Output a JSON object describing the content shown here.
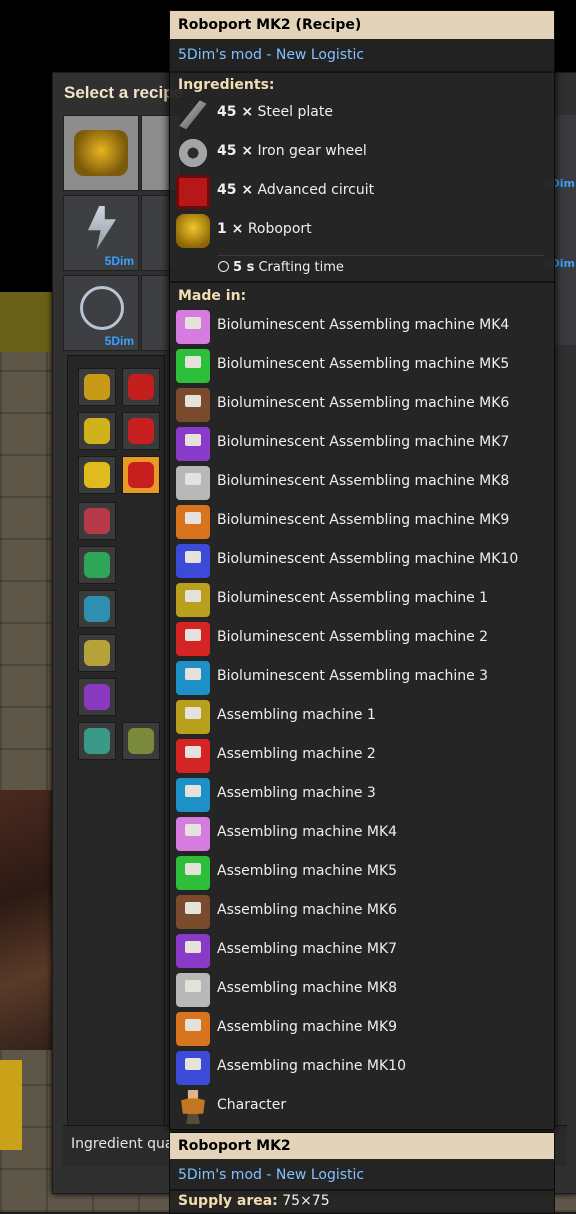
{
  "recipe_window": {
    "title": "Select a recipe",
    "group_badge": "5Dim",
    "bottom_label": "Ingredient quali"
  },
  "tooltip": {
    "title": "Roboport MK2 (Recipe)",
    "mod": "5Dim's mod - New Logistic",
    "ingredients_label": "Ingredients:",
    "ingredients": [
      {
        "amount": "45 ×",
        "name": "Steel plate",
        "icon": "steel-plate-icon"
      },
      {
        "amount": "45 ×",
        "name": "Iron gear wheel",
        "icon": "iron-gear-wheel-icon"
      },
      {
        "amount": "45 ×",
        "name": "Advanced circuit",
        "icon": "advanced-circuit-icon"
      },
      {
        "amount": "1 ×",
        "name": "Roboport",
        "icon": "roboport-icon"
      }
    ],
    "crafting_time_value": "5 s",
    "crafting_time_label": "Crafting time",
    "made_in_label": "Made in:",
    "made_in": [
      {
        "name": "Bioluminescent Assembling machine MK4",
        "color": "#d67be0"
      },
      {
        "name": "Bioluminescent Assembling machine MK5",
        "color": "#2ebf3a"
      },
      {
        "name": "Bioluminescent Assembling machine MK6",
        "color": "#7a4a2c"
      },
      {
        "name": "Bioluminescent Assembling machine MK7",
        "color": "#8a3ac8"
      },
      {
        "name": "Bioluminescent Assembling machine MK8",
        "color": "#b8b8b8"
      },
      {
        "name": "Bioluminescent Assembling machine MK9",
        "color": "#d8741e"
      },
      {
        "name": "Bioluminescent Assembling machine MK10",
        "color": "#3c4ad8"
      },
      {
        "name": "Bioluminescent Assembling machine 1",
        "color": "#b8a01c"
      },
      {
        "name": "Bioluminescent Assembling machine 2",
        "color": "#d42424"
      },
      {
        "name": "Bioluminescent Assembling machine 3",
        "color": "#1e90c8"
      },
      {
        "name": "Assembling machine 1",
        "color": "#b8a01c"
      },
      {
        "name": "Assembling machine 2",
        "color": "#d42424"
      },
      {
        "name": "Assembling machine 3",
        "color": "#1e90c8"
      },
      {
        "name": "Assembling machine MK4",
        "color": "#d67be0"
      },
      {
        "name": "Assembling machine MK5",
        "color": "#2ebf3a"
      },
      {
        "name": "Assembling machine MK6",
        "color": "#7a4a2c"
      },
      {
        "name": "Assembling machine MK7",
        "color": "#8a3ac8"
      },
      {
        "name": "Assembling machine MK8",
        "color": "#b8b8b8"
      },
      {
        "name": "Assembling machine MK9",
        "color": "#d8741e"
      },
      {
        "name": "Assembling machine MK10",
        "color": "#3c4ad8"
      },
      {
        "name": "Character",
        "color": "#c27622"
      }
    ]
  },
  "item_tooltip": {
    "title": "Roboport MK2",
    "mod": "5Dim's mod - New Logistic",
    "supply_label": "Supply area:",
    "supply_value": "75×75"
  },
  "colors": {
    "tooltip_header_bg": "#e3d3b8",
    "mod_text": "#80c2ff",
    "section_heading": "#f4ddb2",
    "selected_slot": "#e89a24"
  }
}
